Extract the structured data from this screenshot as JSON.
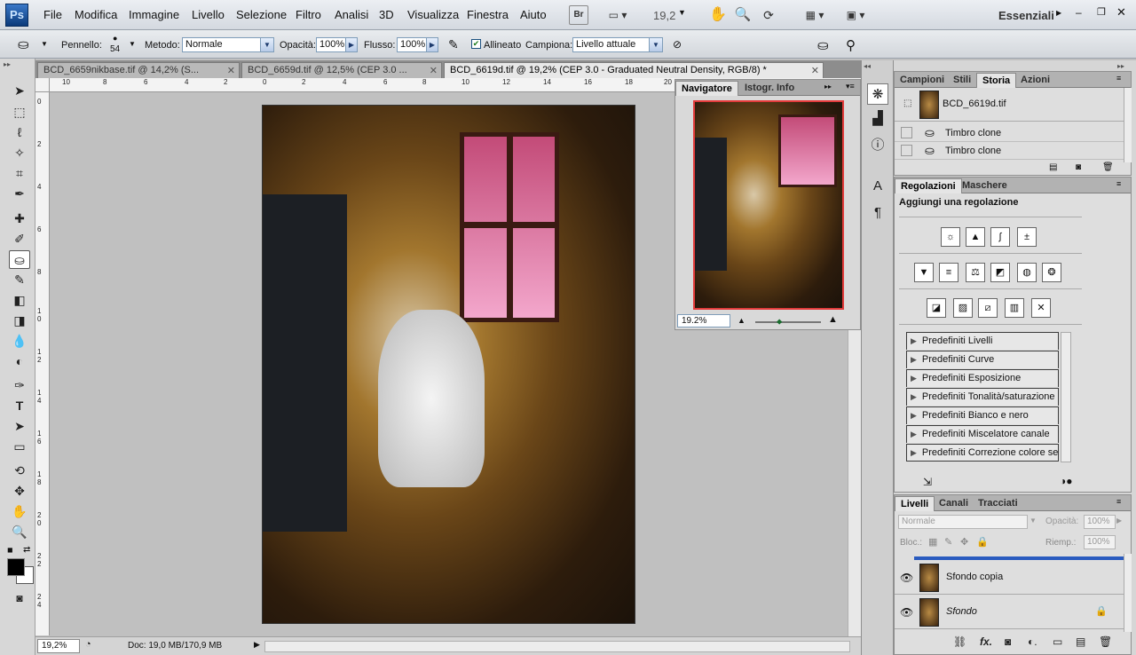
{
  "app": {
    "logo": "Ps",
    "workspace": "Essenziali",
    "zoom": "19,2",
    "bridge_btn": "Br"
  },
  "menu": [
    "File",
    "Modifica",
    "Immagine",
    "Livello",
    "Selezione",
    "Filtro",
    "Analisi",
    "3D",
    "Visualizza",
    "Finestra",
    "Aiuto"
  ],
  "options": {
    "brush_label": "Pennello:",
    "brush_size": "54",
    "mode_label": "Metodo:",
    "mode_value": "Normale",
    "opacity_label": "Opacità:",
    "opacity_value": "100%",
    "flow_label": "Flusso:",
    "flow_value": "100%",
    "aligned_label": "Allineato",
    "aligned_checked": true,
    "sample_label": "Campiona:",
    "sample_value": "Livello attuale"
  },
  "doc_tabs": [
    {
      "label": "BCD_6659nikbase.tif @ 14,2% (S..."
    },
    {
      "label": "BCD_6659d.tif @ 12,5% (CEP 3.0 ..."
    },
    {
      "label": "BCD_6619d.tif @ 19,2% (CEP 3.0 - Graduated Neutral Density, RGB/8) *"
    }
  ],
  "ruler_h": [
    "10",
    "8",
    "6",
    "4",
    "2",
    "0",
    "2",
    "4",
    "6",
    "8",
    "10",
    "12",
    "14",
    "16",
    "18",
    "20"
  ],
  "ruler_v": [
    "0",
    "2",
    "4",
    "6",
    "8",
    "1 0",
    "1 2",
    "1 4",
    "1 6",
    "1 8",
    "2 0",
    "2 2",
    "2 4"
  ],
  "status": {
    "zoom": "19,2%",
    "doc": "Doc: 19,0 MB/170,9 MB"
  },
  "navigator": {
    "tabs": [
      "Navigatore",
      "Istogr.",
      "Info"
    ],
    "zoom": "19.2%"
  },
  "history": {
    "tabs": [
      "Campioni",
      "Stili",
      "Storia",
      "Azioni"
    ],
    "snapshot": "BCD_6619d.tif",
    "items": [
      "Timbro clone",
      "Timbro clone"
    ]
  },
  "adjustments": {
    "tabs": [
      "Regolazioni",
      "Maschere"
    ],
    "heading": "Aggiungi una regolazione",
    "presets": [
      "Predefiniti Livelli",
      "Predefiniti Curve",
      "Predefiniti Esposizione",
      "Predefiniti Tonalità/saturazione",
      "Predefiniti Bianco e nero",
      "Predefiniti Miscelatore canale",
      "Predefiniti Correzione colore sel..."
    ]
  },
  "layers": {
    "tabs": [
      "Livelli",
      "Canali",
      "Tracciati"
    ],
    "blend": "Normale",
    "opacity_label": "Opacità:",
    "opacity_value": "100%",
    "lock_label": "Bloc.:",
    "fill_label": "Riemp.:",
    "fill_value": "100%",
    "items": [
      "Sfondo copia",
      "Sfondo"
    ]
  },
  "colors": {
    "foreground": "#000000",
    "background": "#ffffff",
    "accent": "#3a78c8"
  }
}
